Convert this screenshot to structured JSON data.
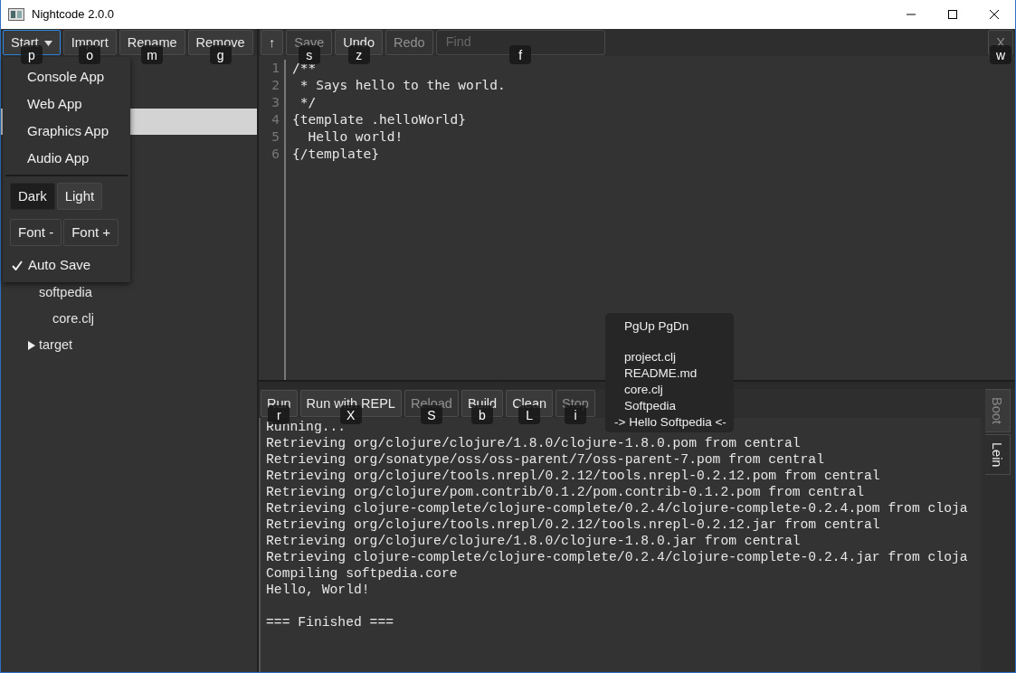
{
  "window": {
    "title": "Nightcode 2.0.0"
  },
  "project_toolbar": {
    "buttons": [
      {
        "label": "Start",
        "kind": "dropdown",
        "shortcut": "p",
        "expanded": true,
        "disabled": false
      },
      {
        "label": "Import",
        "kind": "plain",
        "shortcut": "o",
        "disabled": false
      },
      {
        "label": "Rename",
        "kind": "plain",
        "shortcut": "m",
        "disabled": false
      },
      {
        "label": "Remove",
        "kind": "plain",
        "shortcut": "g",
        "disabled": false
      }
    ]
  },
  "start_menu": {
    "items": [
      {
        "label": "Console App"
      },
      {
        "label": "Web App"
      },
      {
        "label": "Graphics App"
      },
      {
        "label": "Audio App"
      }
    ],
    "theme_buttons": [
      {
        "label": "Dark",
        "selected": true
      },
      {
        "label": "Light",
        "selected": false
      }
    ],
    "font_buttons": [
      {
        "label": "Font -"
      },
      {
        "label": "Font +"
      }
    ],
    "auto_save": {
      "label": "Auto Save",
      "checked": true
    }
  },
  "project_tree": [
    {
      "selected": true
    },
    {
      "label": "softpedia",
      "selected": false,
      "children": [
        {
          "label": "core.clj",
          "selected": false
        }
      ]
    },
    {
      "label": "target",
      "selected": false,
      "expanded": false
    }
  ],
  "editor_toolbar": {
    "buttons": [
      {
        "label": "↑",
        "disabled": false
      },
      {
        "label": "Save",
        "disabled": true,
        "shortcut": "s"
      },
      {
        "label": "Undo",
        "disabled": false,
        "shortcut": "z"
      },
      {
        "label": "Redo",
        "disabled": true
      }
    ],
    "find": {
      "placeholder": "Find",
      "shortcut": "f"
    },
    "close": {
      "label": "X",
      "disabled": true,
      "shortcut": "w"
    }
  },
  "editor": {
    "lines": [
      {
        "number": "1",
        "text": "/**"
      },
      {
        "number": "2",
        "text": " * Says hello to the world."
      },
      {
        "number": "3",
        "text": " */"
      },
      {
        "number": "4",
        "text": "{template .helloWorld}"
      },
      {
        "number": "5",
        "text": "  Hello world!"
      },
      {
        "number": "6",
        "text": "{/template}"
      }
    ]
  },
  "autocomplete": {
    "items": [
      {
        "kind": "header",
        "label": "PgUp PgDn"
      },
      {
        "kind": "file",
        "label": "project.clj"
      },
      {
        "kind": "file",
        "label": "README.md"
      },
      {
        "kind": "file",
        "label": "core.clj"
      },
      {
        "kind": "file",
        "label": "Softpedia"
      },
      {
        "kind": "current",
        "label": "-> Hello Softpedia <-"
      }
    ]
  },
  "build_toolbar": {
    "buttons": [
      {
        "label": "Run",
        "disabled": false,
        "shortcut": "r"
      },
      {
        "label": "Run with REPL",
        "disabled": false,
        "shortcut": "X"
      },
      {
        "label": "Reload",
        "disabled": true,
        "shortcut": "S"
      },
      {
        "label": "Build",
        "disabled": false,
        "shortcut": "b"
      },
      {
        "label": "Clean",
        "disabled": false,
        "shortcut": "L"
      },
      {
        "label": "Stop",
        "disabled": true,
        "shortcut": "i"
      }
    ]
  },
  "output": {
    "lines": [
      {
        "kind": "line",
        "text": "Running..."
      },
      {
        "kind": "line",
        "text": "Retrieving org/clojure/clojure/1.8.0/clojure-1.8.0.pom from central"
      },
      {
        "kind": "line",
        "text": "Retrieving org/sonatype/oss/oss-parent/7/oss-parent-7.pom from central"
      },
      {
        "kind": "line",
        "text": "Retrieving org/clojure/tools.nrepl/0.2.12/tools.nrepl-0.2.12.pom from central"
      },
      {
        "kind": "line",
        "text": "Retrieving org/clojure/pom.contrib/0.1.2/pom.contrib-0.1.2.pom from central"
      },
      {
        "kind": "line",
        "text": "Retrieving clojure-complete/clojure-complete/0.2.4/clojure-complete-0.2.4.pom from cloja"
      },
      {
        "kind": "line",
        "text": "Retrieving org/clojure/tools.nrepl/0.2.12/tools.nrepl-0.2.12.jar from central"
      },
      {
        "kind": "line",
        "text": "Retrieving org/clojure/clojure/1.8.0/clojure-1.8.0.jar from central"
      },
      {
        "kind": "line",
        "text": "Retrieving clojure-complete/clojure-complete/0.2.4/clojure-complete-0.2.4.jar from cloja"
      },
      {
        "kind": "line",
        "text": "Compiling softpedia.core"
      },
      {
        "kind": "line",
        "text": "Hello, World!"
      },
      {
        "kind": "after_gap",
        "text": "=== Finished ==="
      }
    ]
  },
  "build_tabs": [
    {
      "label": "Boot",
      "selected": false
    },
    {
      "label": "Lein",
      "selected": true
    }
  ]
}
